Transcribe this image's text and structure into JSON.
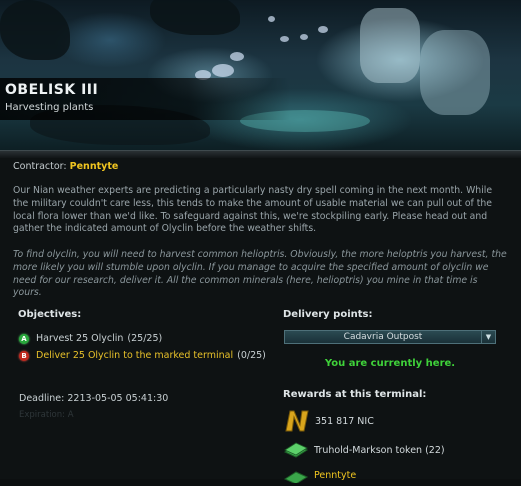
{
  "mission": {
    "title": "OBELISK III",
    "subtitle": "Harvesting plants"
  },
  "contractor": {
    "label": "Contractor:",
    "name": "Penntyte"
  },
  "description": {
    "paragraph1": "Our Nian weather experts are predicting a particularly nasty dry spell coming in the next month. While the military couldn't care less, this tends to make the amount of usable material we can pull out of the local flora lower than we'd like. To safeguard against this, we're stockpiling early. Please head out and gather the indicated amount of Olyclin before the weather shifts.",
    "paragraph2": "To find olyclin, you will need to harvest common helioptris. Obviously, the more heloptris you harvest, the more likely you will stumble upon olyclin. If you manage to acquire the specified amount of olyclin we need for our research, deliver it. All the common minerals (here, helioptris) you mine in that time is yours."
  },
  "objectives": {
    "heading": "Objectives:",
    "items": [
      {
        "badge": "A",
        "text": "Harvest 25 Olyclin",
        "count": "(25/25)",
        "status": "complete",
        "color": "#29a83c"
      },
      {
        "badge": "B",
        "text": "Deliver 25 Olyclin to the marked terminal",
        "count": "(0/25)",
        "status": "active",
        "color": "#c0281e"
      }
    ]
  },
  "deadline": {
    "label": "Deadline:",
    "value": "2213-05-05 05:41:30"
  },
  "ghost_text": {
    "expiration": "Expiration: A"
  },
  "delivery": {
    "heading": "Delivery points:",
    "selected": "Cadavria Outpost",
    "status": "You are currently here."
  },
  "rewards": {
    "heading": "Rewards at this terminal:",
    "items": [
      {
        "icon": "nic-currency-icon",
        "label": "351 817 NIC"
      },
      {
        "icon": "token-icon",
        "label": "Truhold-Markson token (22)"
      },
      {
        "icon": "faction-icon",
        "label": "Penntyte"
      }
    ]
  },
  "colors": {
    "accent_yellow": "#f0c520",
    "status_green": "#3fd23a",
    "complete_badge": "#29a83c",
    "active_badge": "#c0281e"
  }
}
